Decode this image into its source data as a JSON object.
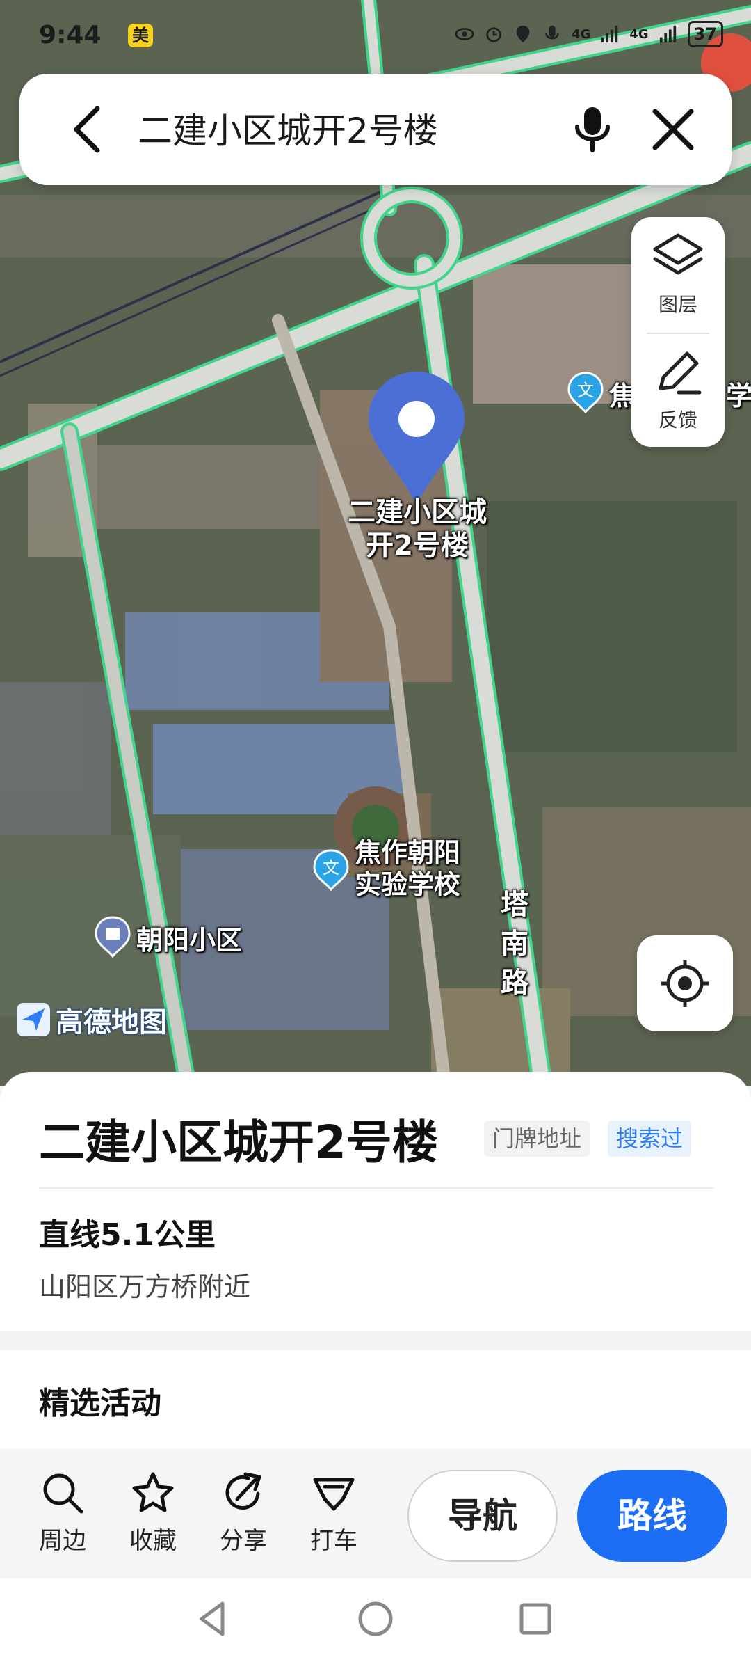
{
  "status_bar": {
    "time": "9:44",
    "badge": "美",
    "battery": "37",
    "net1": "4G",
    "net2": "4G"
  },
  "search": {
    "query": "二建小区城开2号楼"
  },
  "map_controls": {
    "layers_label": "图层",
    "feedback_label": "反馈"
  },
  "map": {
    "pin_label_line1": "二建小区城",
    "pin_label_line2": "开2号楼",
    "poi_school_line1": "焦作朝阳",
    "poi_school_line2": "实验学校",
    "poi_residential": "朝阳小区",
    "road_name_1": "塔",
    "road_name_2": "南",
    "road_name_3": "路",
    "poi_edge_1": "焦",
    "poi_edge_2": "学",
    "watermark": "高德地图"
  },
  "place": {
    "title": "二建小区城开2号楼",
    "tag_address": "门牌地址",
    "tag_searched": "搜索过",
    "distance": "直线5.1公里",
    "area": "山阳区万方桥附近",
    "section_title": "精选活动"
  },
  "actions": {
    "nearby": "周边",
    "favorite": "收藏",
    "share": "分享",
    "taxi": "打车",
    "navigate": "导航",
    "route": "路线"
  },
  "colors": {
    "accent": "#1c6ef5",
    "pin": "#4c6fd6",
    "road": "#3fd58a"
  }
}
